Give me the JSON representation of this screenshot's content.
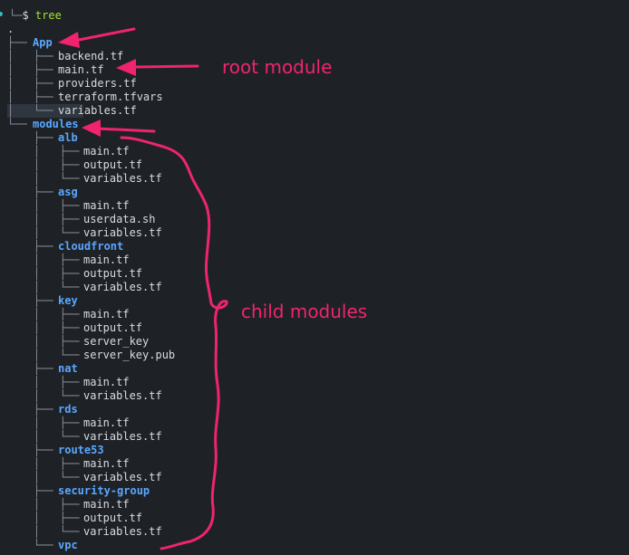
{
  "prompt": {
    "arrow": "└─",
    "symbol": "$",
    "command": "tree"
  },
  "root": ".",
  "tree": [
    {
      "depth": 0,
      "name": "App",
      "type": "dir"
    },
    {
      "depth": 1,
      "name": "backend.tf",
      "type": "file"
    },
    {
      "depth": 1,
      "name": "main.tf",
      "type": "file"
    },
    {
      "depth": 1,
      "name": "providers.tf",
      "type": "file"
    },
    {
      "depth": 1,
      "name": "terraform.tfvars",
      "type": "file"
    },
    {
      "depth": 1,
      "name": "variables.tf",
      "type": "file"
    },
    {
      "depth": 0,
      "name": "modules",
      "type": "dir"
    },
    {
      "depth": 1,
      "name": "alb",
      "type": "dir"
    },
    {
      "depth": 2,
      "name": "main.tf",
      "type": "file"
    },
    {
      "depth": 2,
      "name": "output.tf",
      "type": "file"
    },
    {
      "depth": 2,
      "name": "variables.tf",
      "type": "file"
    },
    {
      "depth": 1,
      "name": "asg",
      "type": "dir"
    },
    {
      "depth": 2,
      "name": "main.tf",
      "type": "file"
    },
    {
      "depth": 2,
      "name": "userdata.sh",
      "type": "file"
    },
    {
      "depth": 2,
      "name": "variables.tf",
      "type": "file"
    },
    {
      "depth": 1,
      "name": "cloudfront",
      "type": "dir"
    },
    {
      "depth": 2,
      "name": "main.tf",
      "type": "file"
    },
    {
      "depth": 2,
      "name": "output.tf",
      "type": "file"
    },
    {
      "depth": 2,
      "name": "variables.tf",
      "type": "file"
    },
    {
      "depth": 1,
      "name": "key",
      "type": "dir"
    },
    {
      "depth": 2,
      "name": "main.tf",
      "type": "file"
    },
    {
      "depth": 2,
      "name": "output.tf",
      "type": "file"
    },
    {
      "depth": 2,
      "name": "server_key",
      "type": "file"
    },
    {
      "depth": 2,
      "name": "server_key.pub",
      "type": "file"
    },
    {
      "depth": 1,
      "name": "nat",
      "type": "dir"
    },
    {
      "depth": 2,
      "name": "main.tf",
      "type": "file"
    },
    {
      "depth": 2,
      "name": "variables.tf",
      "type": "file"
    },
    {
      "depth": 1,
      "name": "rds",
      "type": "dir"
    },
    {
      "depth": 2,
      "name": "main.tf",
      "type": "file"
    },
    {
      "depth": 2,
      "name": "variables.tf",
      "type": "file"
    },
    {
      "depth": 1,
      "name": "route53",
      "type": "dir"
    },
    {
      "depth": 2,
      "name": "main.tf",
      "type": "file"
    },
    {
      "depth": 2,
      "name": "variables.tf",
      "type": "file"
    },
    {
      "depth": 1,
      "name": "security-group",
      "type": "dir"
    },
    {
      "depth": 2,
      "name": "main.tf",
      "type": "file"
    },
    {
      "depth": 2,
      "name": "output.tf",
      "type": "file"
    },
    {
      "depth": 2,
      "name": "variables.tf",
      "type": "file"
    },
    {
      "depth": 1,
      "name": "vpc",
      "type": "dir"
    }
  ],
  "annotations": {
    "root_label": "root module",
    "child_label": "child modules"
  },
  "colors": {
    "background": "#1e2227",
    "directory": "#5aa7ff",
    "file": "#d8dbe0",
    "command": "#a6e22e",
    "annotation": "#f0246e"
  }
}
